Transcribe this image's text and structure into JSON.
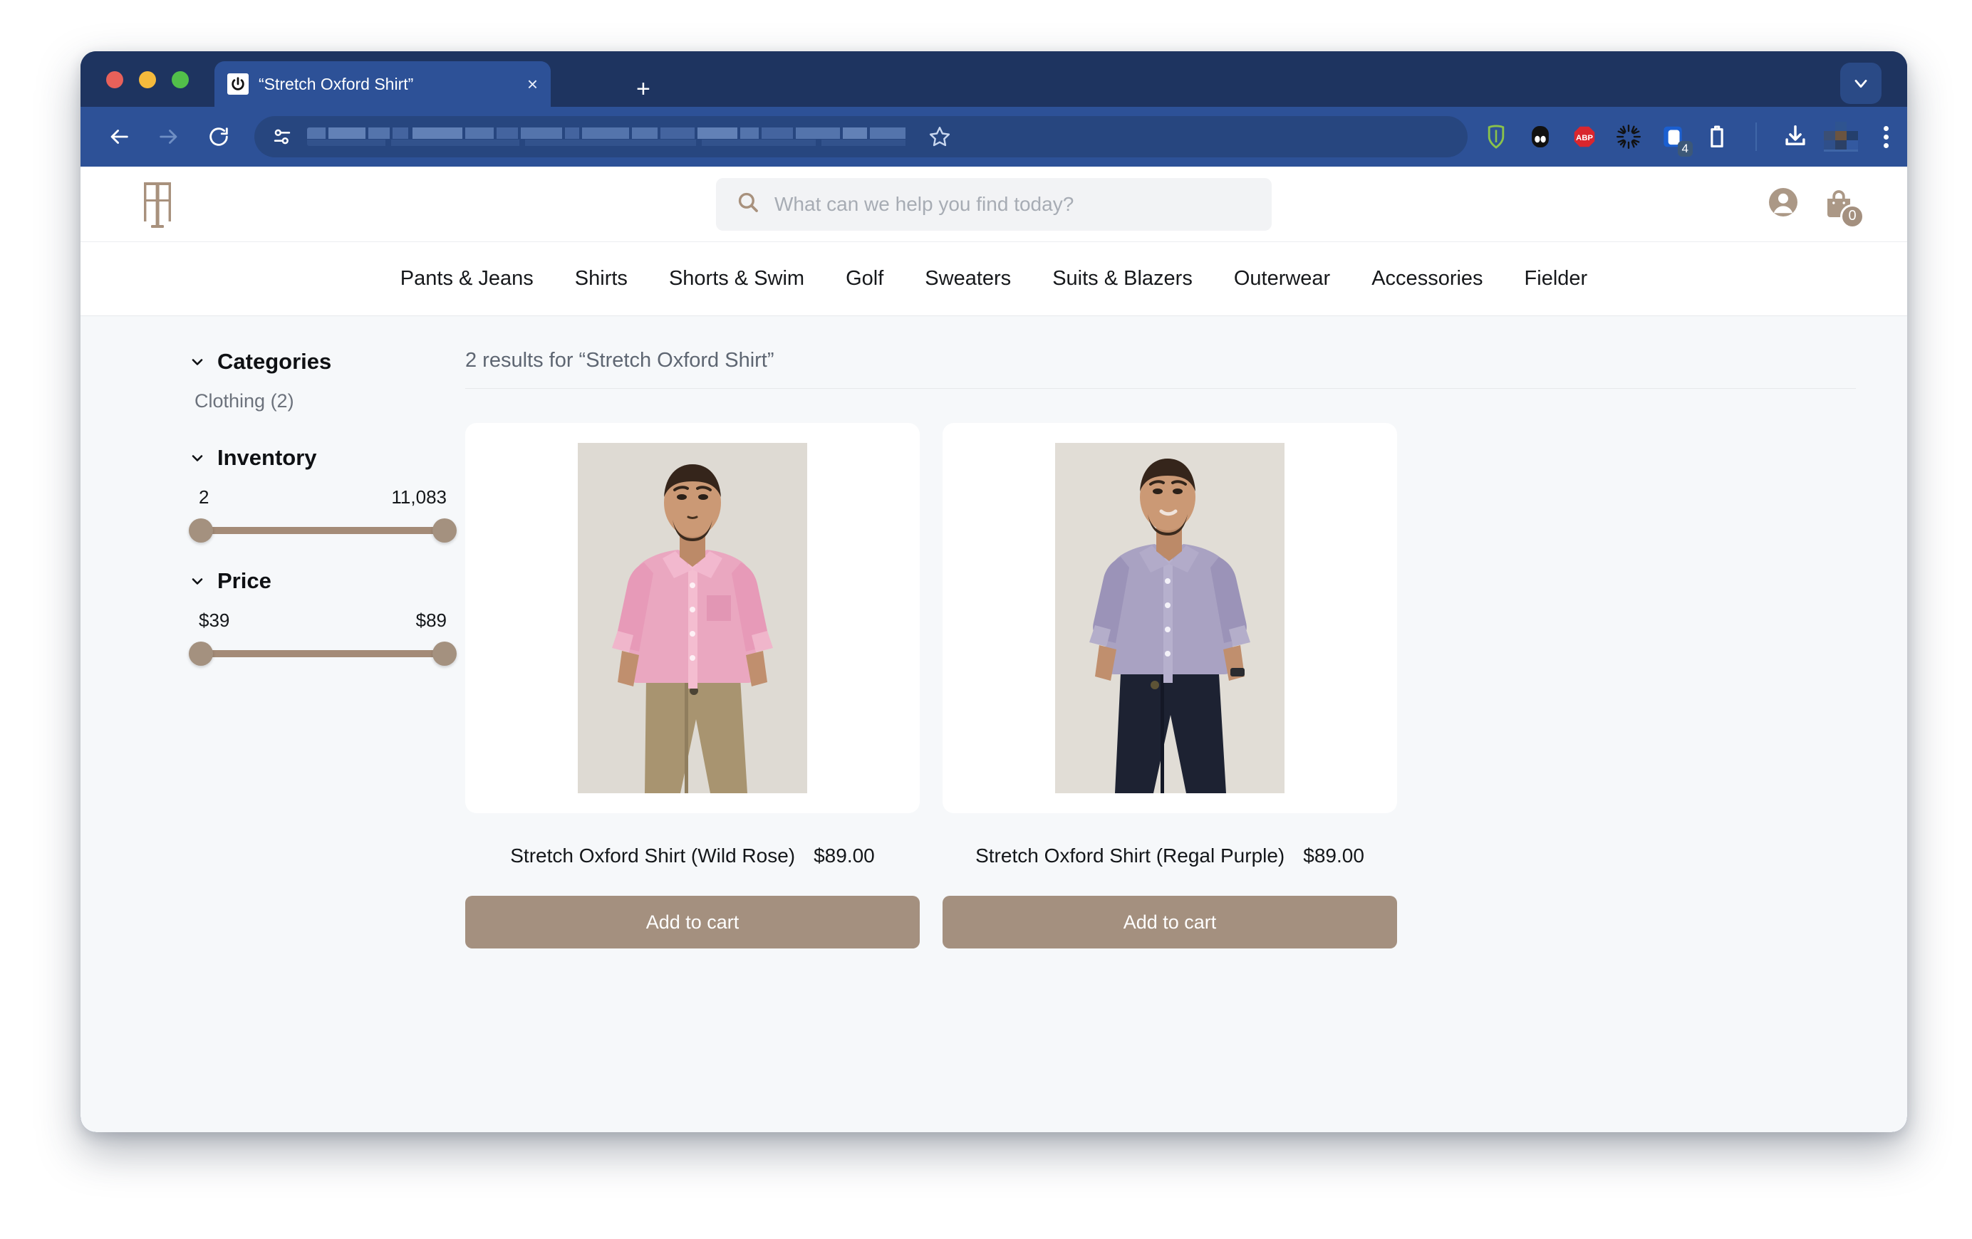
{
  "browser": {
    "tab_title": "“Stretch Oxford Shirt”",
    "tab_close_label": "×",
    "new_tab_label": "+",
    "back_label": "back",
    "forward_label": "forward",
    "reload_label": "reload",
    "url_value": "",
    "extensions": [
      {
        "name": "bitwarden-icon",
        "badge": ""
      },
      {
        "name": "ghostery-icon",
        "badge": ""
      },
      {
        "name": "adblock-plus-icon",
        "badge": "ABP"
      },
      {
        "name": "sunburst-extension-icon",
        "badge": ""
      },
      {
        "name": "tab-manager-icon",
        "badge": "4"
      },
      {
        "name": "clipboard-extension-icon",
        "badge": ""
      }
    ],
    "window_menu_label": "⌄"
  },
  "site": {
    "logo_letter": "T",
    "search": {
      "placeholder": "What can we help you find today?",
      "value": ""
    },
    "cart_count": "0",
    "nav": [
      {
        "label": "Pants & Jeans"
      },
      {
        "label": "Shirts"
      },
      {
        "label": "Shorts & Swim"
      },
      {
        "label": "Golf"
      },
      {
        "label": "Sweaters"
      },
      {
        "label": "Suits & Blazers"
      },
      {
        "label": "Outerwear"
      },
      {
        "label": "Accessories"
      },
      {
        "label": "Fielder"
      }
    ]
  },
  "sidebar": {
    "categories": {
      "title": "Categories",
      "options": [
        {
          "label": "Clothing (2)"
        }
      ]
    },
    "inventory": {
      "title": "Inventory",
      "min": "2",
      "max": "11,083"
    },
    "price": {
      "title": "Price",
      "min": "$39",
      "max": "$89"
    }
  },
  "results": {
    "summary": "2 results for “Stretch Oxford Shirt”",
    "add_to_cart_label": "Add to cart",
    "products": [
      {
        "name": "Stretch Oxford Shirt (Wild Rose)",
        "price": "$89.00",
        "shirt_color": "#eaa7c0",
        "pants_color": "#a89470",
        "image_alt": "male-model-pink-oxford-shirt"
      },
      {
        "name": "Stretch Oxford Shirt (Regal Purple)",
        "price": "$89.00",
        "shirt_color": "#a9a2c2",
        "pants_color": "#1d2232",
        "image_alt": "male-model-purple-oxford-shirt"
      }
    ]
  },
  "colors": {
    "brand_tan": "#a4907f",
    "browser_navy": "#1e3460",
    "toolbar_blue": "#2d5197",
    "page_bg": "#f6f8fa"
  }
}
